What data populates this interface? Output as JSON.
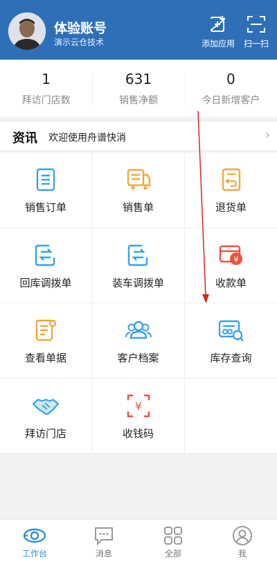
{
  "header": {
    "user_name": "体验账号",
    "company": "演示云仓技术",
    "add_app_label": "添加应用",
    "scan_label": "扫一扫",
    "background_color": "#2f6fb8"
  },
  "stats": [
    {
      "value": "1",
      "label": "拜访门店数"
    },
    {
      "value": "631",
      "label": "销售净额"
    },
    {
      "value": "0",
      "label": "今日新增客户"
    }
  ],
  "news": {
    "title": "资讯",
    "text": "欢迎使用舟谱快消"
  },
  "tiles": [
    {
      "label": "销售订单",
      "icon": "sales-order-icon"
    },
    {
      "label": "销售单",
      "icon": "sales-slip-icon"
    },
    {
      "label": "退货单",
      "icon": "return-slip-icon"
    },
    {
      "label": "回库调拨单",
      "icon": "return-transfer-icon"
    },
    {
      "label": "装车调拨单",
      "icon": "loading-transfer-icon"
    },
    {
      "label": "收款单",
      "icon": "receipt-icon"
    },
    {
      "label": "查看单据",
      "icon": "view-documents-icon"
    },
    {
      "label": "客户档案",
      "icon": "customer-archive-icon"
    },
    {
      "label": "库存查询",
      "icon": "inventory-query-icon"
    },
    {
      "label": "拜访门店",
      "icon": "handshake-icon"
    },
    {
      "label": "收钱码",
      "icon": "payment-code-icon"
    }
  ],
  "tabbar": [
    {
      "label": "工作台",
      "icon": "workbench-icon",
      "active": true
    },
    {
      "label": "消息",
      "icon": "message-icon"
    },
    {
      "label": "全部",
      "icon": "grid-icon"
    },
    {
      "label": "我",
      "icon": "profile-icon"
    }
  ],
  "colors": {
    "accent": "#2b8fe0",
    "icon_blue": "#3aa0e8",
    "icon_orange": "#f0a83c",
    "icon_red": "#e8553e",
    "annotation_arrow": "#d9261c"
  }
}
